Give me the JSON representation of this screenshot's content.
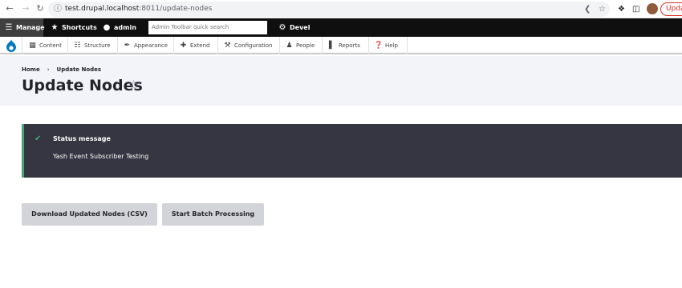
{
  "browser": {
    "url_host": "test.drupal.localhost",
    "url_path": ":8011/update-nodes",
    "update_label": "Update"
  },
  "toolbar": {
    "manage": "Manage",
    "shortcuts": "Shortcuts",
    "user": "admin",
    "search_placeholder": "Admin Toolbar quick search",
    "devel": "Devel"
  },
  "menu": {
    "items": [
      {
        "label": "Content",
        "icon": "content-icon"
      },
      {
        "label": "Structure",
        "icon": "structure-icon"
      },
      {
        "label": "Appearance",
        "icon": "appearance-icon"
      },
      {
        "label": "Extend",
        "icon": "extend-icon"
      },
      {
        "label": "Configuration",
        "icon": "configuration-icon"
      },
      {
        "label": "People",
        "icon": "people-icon"
      },
      {
        "label": "Reports",
        "icon": "reports-icon"
      },
      {
        "label": "Help",
        "icon": "help-icon"
      }
    ]
  },
  "breadcrumb": {
    "home": "Home",
    "current": "Update Nodes"
  },
  "page": {
    "title": "Update Nodes"
  },
  "status": {
    "title": "Status message",
    "message": "Yash Event Subscriber Testing"
  },
  "actions": {
    "download": "Download Updated Nodes (CSV)",
    "batch": "Start Batch Processing"
  },
  "colors": {
    "toolbar_bg": "#0f0f0f",
    "status_bg": "#353641",
    "status_accent": "#42a877",
    "button_bg": "#d3d4d9",
    "page_head_bg": "#f3f4f9"
  }
}
